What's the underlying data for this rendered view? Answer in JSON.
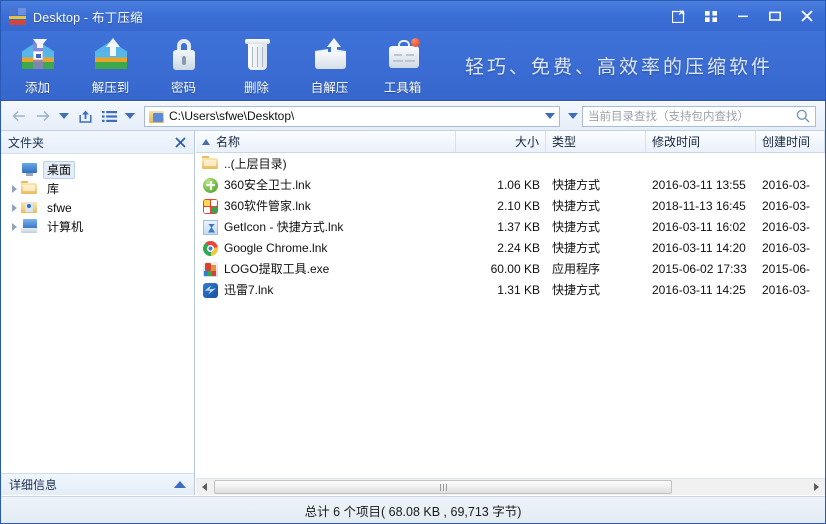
{
  "window": {
    "title": "Desktop - 布丁压缩",
    "controls": {
      "compose": "compose-icon",
      "apps": "apps-grid-icon",
      "minimize": "minimize-icon",
      "maximize": "maximize-icon",
      "close": "close-icon"
    }
  },
  "toolbar": {
    "items": [
      {
        "label": "添加",
        "icon": "add-archive-icon"
      },
      {
        "label": "解压到",
        "icon": "extract-to-icon"
      },
      {
        "label": "密码",
        "icon": "lock-icon"
      },
      {
        "label": "删除",
        "icon": "trash-icon"
      },
      {
        "label": "自解压",
        "icon": "self-extract-icon"
      },
      {
        "label": "工具箱",
        "icon": "toolbox-icon"
      }
    ],
    "slogan": "轻巧、免费、高效率的压缩软件"
  },
  "addressbar": {
    "back": "back-arrow-icon",
    "forward": "forward-arrow-icon",
    "history_caret": "chevron-down-icon",
    "up": "up-arrow-box-icon",
    "views": "list-view-icon",
    "views_caret": "chevron-down-icon",
    "path": "C:\\Users\\sfwe\\Desktop\\",
    "path_caret": "chevron-down-icon",
    "search_caret": "chevron-down-icon",
    "search_placeholder": "当前目录查找（支持包内查找）",
    "search_value": "",
    "search_icon": "search-icon"
  },
  "sidebar": {
    "header": "文件夹",
    "close_icon": "close-icon",
    "tree": [
      {
        "label": "桌面",
        "icon": "desktop-icon",
        "selected": true,
        "expandable": false
      },
      {
        "label": "库",
        "icon": "library-folder-icon",
        "selected": false,
        "expandable": true
      },
      {
        "label": "sfwe",
        "icon": "user-folder-icon",
        "selected": false,
        "expandable": true
      },
      {
        "label": "计算机",
        "icon": "computer-icon",
        "selected": false,
        "expandable": true
      }
    ],
    "details_label": "详细信息",
    "details_caret": "chevron-up-icon"
  },
  "filelist": {
    "columns": [
      {
        "key": "name",
        "label": "名称",
        "align": "left",
        "sorted": true
      },
      {
        "key": "size",
        "label": "大小",
        "align": "right",
        "sorted": false
      },
      {
        "key": "type",
        "label": "类型",
        "align": "left",
        "sorted": false
      },
      {
        "key": "modified",
        "label": "修改时间",
        "align": "left",
        "sorted": false
      },
      {
        "key": "created",
        "label": "创建时间",
        "align": "left",
        "sorted": false
      }
    ],
    "rows": [
      {
        "name": "..(上层目录)",
        "size": "",
        "type": "",
        "modified": "",
        "created": "",
        "icon": "folder-up-icon"
      },
      {
        "name": "360安全卫士.lnk",
        "size": "1.06 KB",
        "type": "快捷方式",
        "modified": "2016-03-11 13:55",
        "created": "2016-03-",
        "icon": "360-safe-icon"
      },
      {
        "name": "360软件管家.lnk",
        "size": "2.10 KB",
        "type": "快捷方式",
        "modified": "2018-11-13 16:45",
        "created": "2016-03-",
        "icon": "360-software-icon"
      },
      {
        "name": "GetIcon - 快捷方式.lnk",
        "size": "1.37 KB",
        "type": "快捷方式",
        "modified": "2016-03-11 16:02",
        "created": "2016-03-",
        "icon": "geticon-icon"
      },
      {
        "name": "Google Chrome.lnk",
        "size": "2.24 KB",
        "type": "快捷方式",
        "modified": "2016-03-11 14:20",
        "created": "2016-03-",
        "icon": "chrome-icon"
      },
      {
        "name": "LOGO提取工具.exe",
        "size": "60.00 KB",
        "type": "应用程序",
        "modified": "2015-06-02 17:33",
        "created": "2015-06-",
        "icon": "logo-tool-icon"
      },
      {
        "name": "迅雷7.lnk",
        "size": "1.31 KB",
        "type": "快捷方式",
        "modified": "2016-03-11 14:25",
        "created": "2016-03-",
        "icon": "thunder-icon"
      }
    ],
    "scroll_left_icon": "scroll-left-arrow-icon",
    "scroll_right_icon": "scroll-right-arrow-icon"
  },
  "statusbar": {
    "text": "总计 6 个项目( 68.08 KB , 69,713 字节)"
  },
  "colors": {
    "title_blue": "#3c6fd6",
    "toolbar_blue": "#3a6cd3",
    "accent": "#3d6cbe",
    "selection": "#e4ecf7"
  }
}
